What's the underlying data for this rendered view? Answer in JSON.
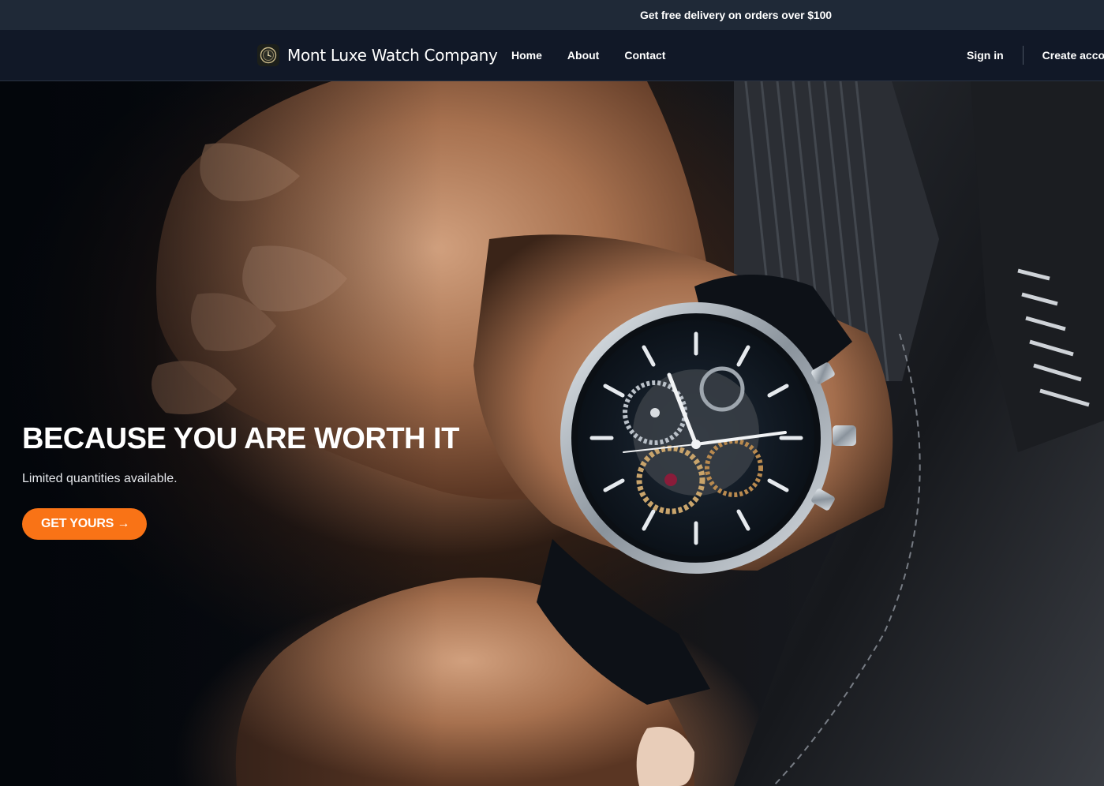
{
  "promo": {
    "text": "Get free delivery on orders over $100"
  },
  "nav": {
    "brand_name": "Mont Luxe Watch Company",
    "logo_icon": "watch-logo-icon",
    "links": [
      {
        "label": "Home"
      },
      {
        "label": "About"
      },
      {
        "label": "Contact"
      }
    ],
    "sign_in": "Sign in",
    "create_account": "Create account"
  },
  "hero": {
    "title": "BECAUSE YOU ARE WORTH IT",
    "subtitle": "Limited quantities available.",
    "cta_label": "GET YOURS →",
    "image_subject": "wristwatch-on-wrist-photo"
  },
  "colors": {
    "promo_bg": "#1f2937",
    "nav_bg": "#111827",
    "accent": "#f97316",
    "text": "#ffffff"
  }
}
